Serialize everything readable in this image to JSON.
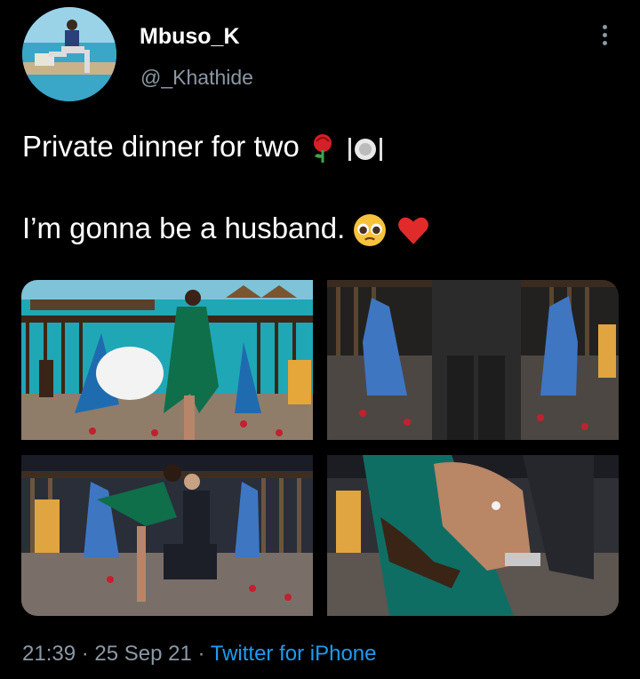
{
  "user": {
    "display_name": "Mbuso_K",
    "handle": "@_Khathide"
  },
  "tweet": {
    "line1": "Private dinner for two",
    "line1_emojis": [
      "rose-emoji",
      "fork-knife-plate-emoji"
    ],
    "line2": "I’m gonna be a husband.",
    "line2_emojis": [
      "pleading-face-emoji",
      "red-heart-emoji"
    ]
  },
  "meta": {
    "time": "21:39",
    "sep1": " · ",
    "date": "25 Sep 21",
    "sep2": " · ",
    "source": "Twitter for iPhone"
  },
  "colors": {
    "background": "#000000",
    "muted": "#8b98a5",
    "link": "#1d9bf0"
  }
}
